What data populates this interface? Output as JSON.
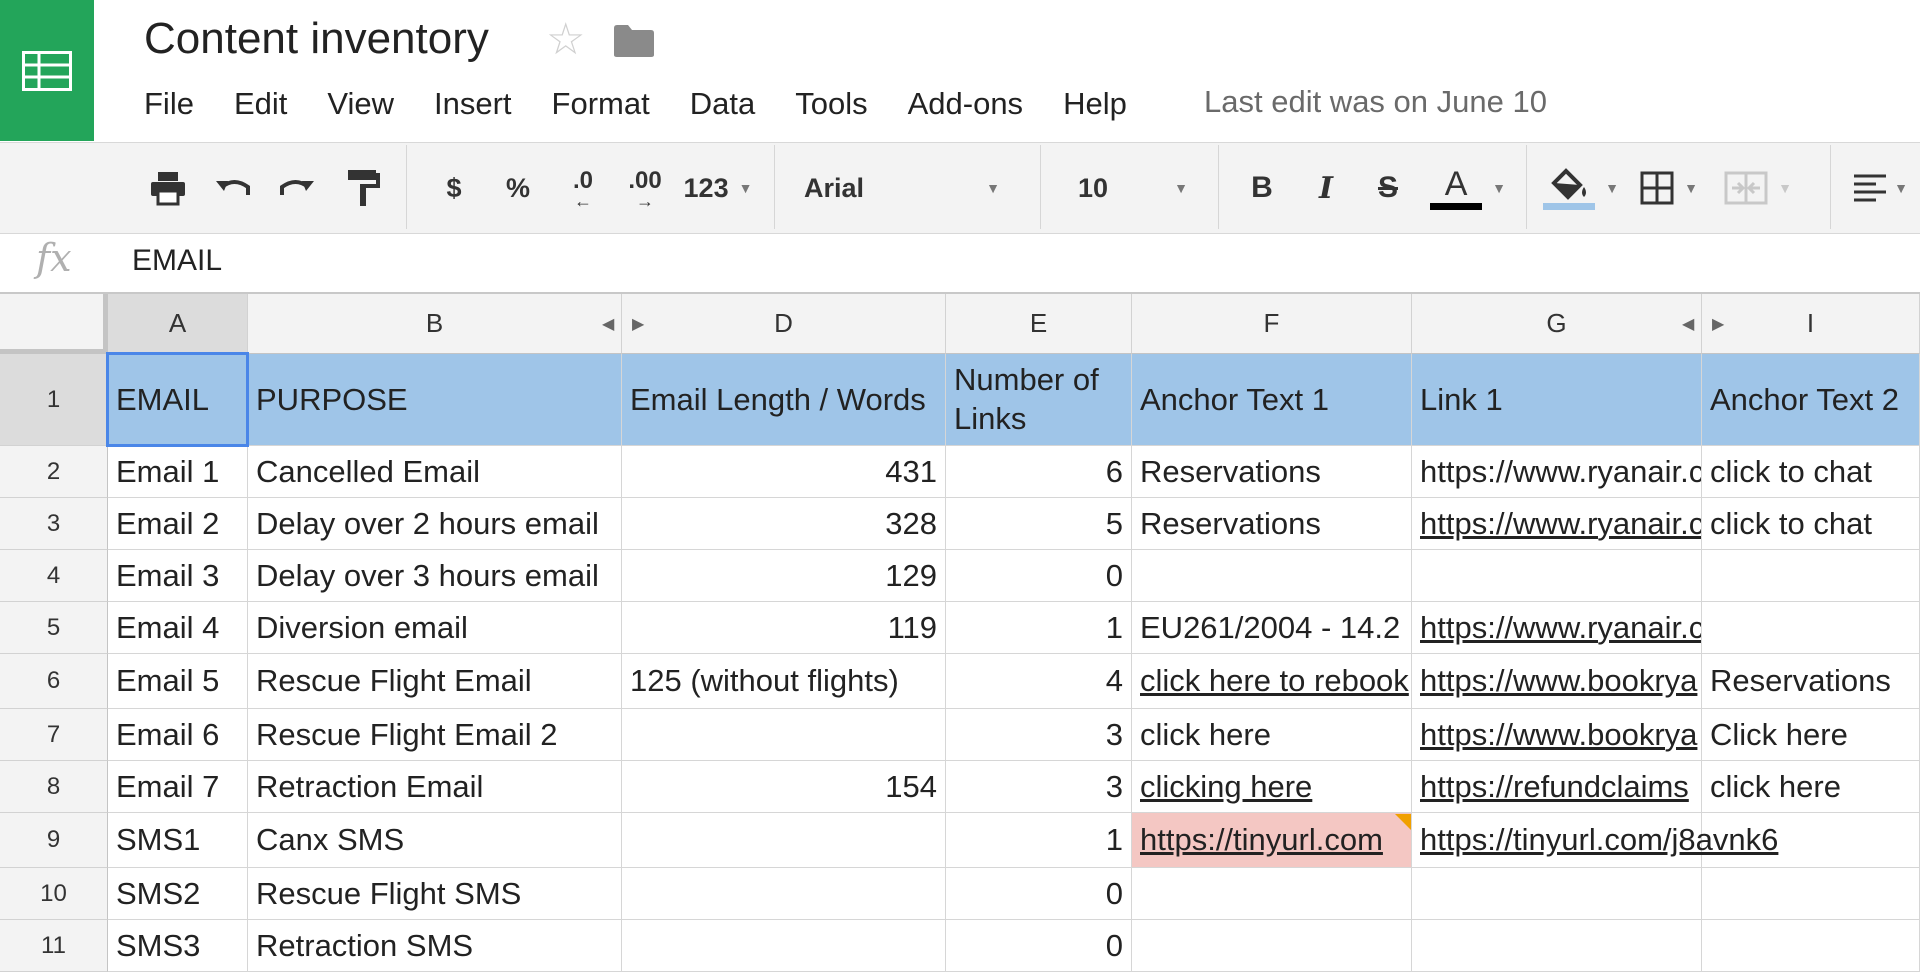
{
  "document": {
    "title": "Content inventory",
    "last_edit": "Last edit was on June 10"
  },
  "icons": {
    "logo": "sheets-logo-icon",
    "star": "star-icon",
    "folder": "folder-icon"
  },
  "menu": [
    "File",
    "Edit",
    "View",
    "Insert",
    "Format",
    "Data",
    "Tools",
    "Add-ons",
    "Help"
  ],
  "toolbar": {
    "currency": "$",
    "percent": "%",
    "decrease_decimal": ".0",
    "increase_decimal": ".00",
    "more_formats": "123",
    "font": "Arial",
    "font_size": "10",
    "bold": "B",
    "italic": "I",
    "strikethrough": "S",
    "text_color": "A"
  },
  "colors": {
    "logo_green": "#23a55a",
    "header_fill": "#9fc5e8",
    "selection": "#4a86e8",
    "error_fill": "#f4c7c3",
    "fill_underline": "#9fc5e8"
  },
  "formula_bar": {
    "fx": "fx",
    "value": "EMAIL"
  },
  "grid": {
    "column_headers": [
      "A",
      "B",
      "D",
      "E",
      "F",
      "G",
      "I"
    ],
    "row_numbers": [
      "1",
      "2",
      "3",
      "4",
      "5",
      "6",
      "7",
      "8",
      "9",
      "10",
      "11"
    ],
    "header_row": {
      "email": "EMAIL",
      "purpose": "PURPOSE",
      "length": "Email Length / Words",
      "links": "Number of Links",
      "anchor1": "Anchor Text 1",
      "link1": "Link 1",
      "anchor2": "Anchor Text 2"
    },
    "rows": [
      {
        "email": "Email 1",
        "purpose": "Cancelled Email",
        "length": "431",
        "links": "6",
        "anchor1": "Reservations",
        "link1": "https://www.ryanair.c",
        "anchor2": "click to chat"
      },
      {
        "email": "Email 2",
        "purpose": "Delay over 2 hours email",
        "length": "328",
        "links": "5",
        "anchor1": "Reservations",
        "link1": "https://www.ryanair.c",
        "anchor2": "click to chat"
      },
      {
        "email": "Email 3",
        "purpose": "Delay over 3 hours email",
        "length": "129",
        "links": "0",
        "anchor1": "",
        "link1": "",
        "anchor2": ""
      },
      {
        "email": "Email 4",
        "purpose": "Diversion email",
        "length": "119",
        "links": "1",
        "anchor1": "EU261/2004 - 14.2",
        "link1": "https://www.ryanair.c",
        "anchor2": ""
      },
      {
        "email": "Email 5",
        "purpose": "Rescue Flight Email",
        "length": "125 (without flights)",
        "links": "4",
        "anchor1": "click here to rebook",
        "link1": "https://www.bookrya",
        "anchor2": "Reservations"
      },
      {
        "email": "Email 6",
        "purpose": "Rescue Flight Email 2",
        "length": "",
        "links": "3",
        "anchor1": "click here",
        "link1": "https://www.bookrya",
        "anchor2": "Click here"
      },
      {
        "email": "Email 7",
        "purpose": "Retraction Email",
        "length": "154",
        "links": "3",
        "anchor1": "clicking here",
        "link1": "https://refundclaims",
        "anchor2": "click here"
      },
      {
        "email": "SMS1",
        "purpose": "Canx SMS",
        "length": "",
        "links": "1",
        "anchor1": "https://tinyurl.com",
        "link1": "https://tinyurl.com/j8avnk6",
        "anchor2": ""
      },
      {
        "email": "SMS2",
        "purpose": "Rescue Flight SMS",
        "length": "",
        "links": "0",
        "anchor1": "",
        "link1": "",
        "anchor2": ""
      },
      {
        "email": "SMS3",
        "purpose": "Retraction SMS",
        "length": "",
        "links": "0",
        "anchor1": "",
        "link1": "",
        "anchor2": ""
      }
    ]
  }
}
